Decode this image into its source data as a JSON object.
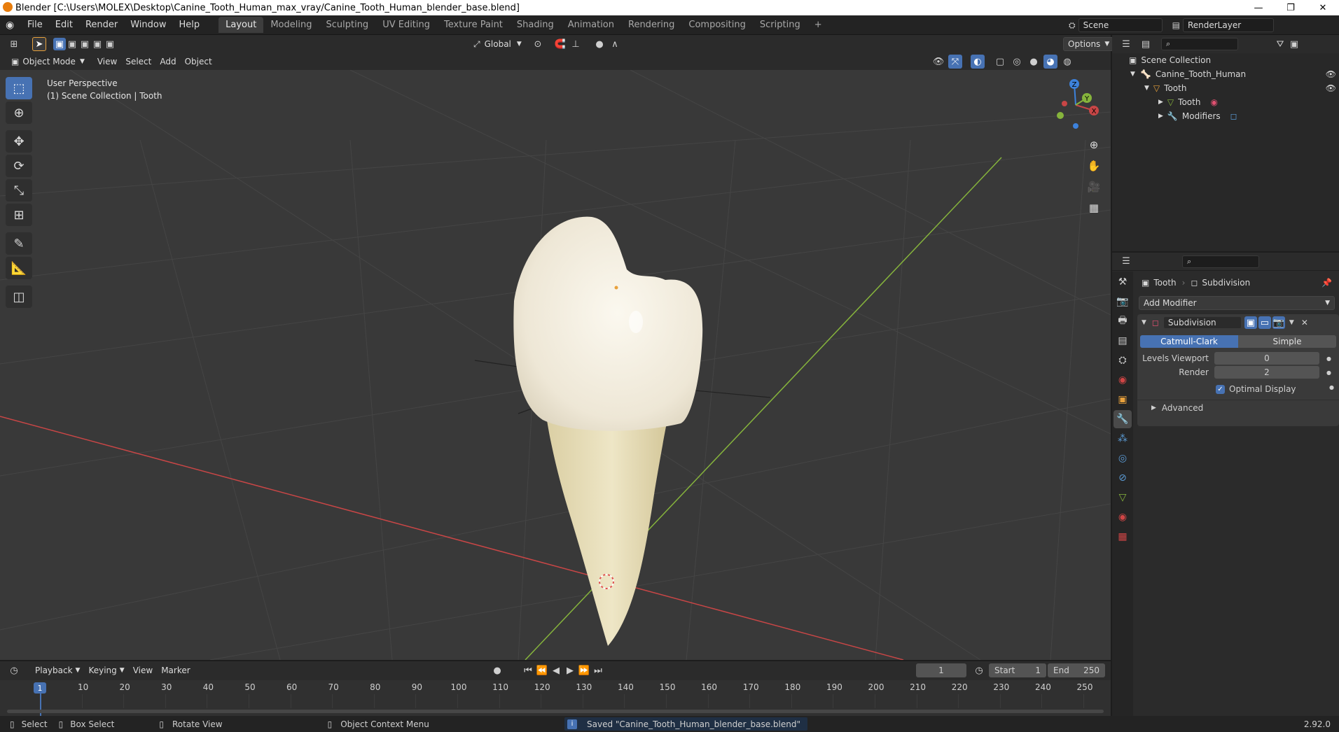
{
  "window": {
    "title": "Blender [C:\\Users\\MOLEX\\Desktop\\Canine_Tooth_Human_max_vray/Canine_Tooth_Human_blender_base.blend]",
    "minimize": "—",
    "restore": "❐",
    "close": "✕"
  },
  "menu": [
    "File",
    "Edit",
    "Render",
    "Window",
    "Help"
  ],
  "workspaces": [
    "Layout",
    "Modeling",
    "Sculpting",
    "UV Editing",
    "Texture Paint",
    "Shading",
    "Animation",
    "Rendering",
    "Compositing",
    "Scripting"
  ],
  "workspace_add": "+",
  "scene": {
    "name": "Scene",
    "renderlayer": "RenderLayer"
  },
  "viewport_header": {
    "transform_orientation": "Global",
    "options": "Options",
    "mode": "Object Mode",
    "menus": [
      "View",
      "Select",
      "Add",
      "Object"
    ]
  },
  "viewport": {
    "perspective": "User Perspective",
    "collection_info": "(1) Scene Collection | Tooth",
    "gizmo_axes": {
      "x": "X",
      "y": "Y",
      "z": "Z"
    }
  },
  "tools": [
    {
      "name": "select-box-tool",
      "glyph": "⬚",
      "active": true
    },
    {
      "name": "cursor-tool",
      "glyph": "⊕"
    },
    {
      "name": "move-tool",
      "glyph": "✥"
    },
    {
      "name": "rotate-tool",
      "glyph": "⟳"
    },
    {
      "name": "scale-tool",
      "glyph": "⤡"
    },
    {
      "name": "transform-tool",
      "glyph": "⊞"
    },
    {
      "name": "annotate-tool",
      "glyph": "✎"
    },
    {
      "name": "measure-tool",
      "glyph": "📏"
    },
    {
      "name": "add-cube-tool",
      "glyph": "◫"
    }
  ],
  "outliner": {
    "items": [
      {
        "label": "Scene Collection",
        "indent": 0
      },
      {
        "label": "Canine_Tooth_Human",
        "indent": 1
      },
      {
        "label": "Tooth",
        "indent": 2
      },
      {
        "label": "Tooth",
        "indent": 3
      },
      {
        "label": "Modifiers",
        "indent": 3
      }
    ]
  },
  "properties": {
    "breadcrumb_object": "Tooth",
    "breadcrumb_modifier": "Subdivision",
    "add_modifier": "Add Modifier",
    "modifier_name": "Subdivision",
    "catmull_clark": "Catmull-Clark",
    "simple": "Simple",
    "levels_viewport_label": "Levels Viewport",
    "levels_viewport_value": "0",
    "render_label": "Render",
    "render_value": "2",
    "optimal_display": "Optimal Display",
    "optimal_display_checked": true,
    "advanced": "Advanced"
  },
  "timeline": {
    "menus": [
      "Playback",
      "Keying",
      "View",
      "Marker"
    ],
    "current_frame": "1",
    "start_label": "Start",
    "start_value": "1",
    "end_label": "End",
    "end_value": "250",
    "ticks": [
      "10",
      "20",
      "30",
      "40",
      "50",
      "60",
      "70",
      "80",
      "90",
      "100",
      "110",
      "120",
      "130",
      "140",
      "150",
      "160",
      "170",
      "180",
      "190",
      "200",
      "210",
      "220",
      "230",
      "240",
      "250"
    ],
    "playhead": "1"
  },
  "statusbar": {
    "select": "Select",
    "box_select": "Box Select",
    "rotate_view": "Rotate View",
    "context_menu": "Object Context Menu",
    "message": "Saved \"Canine_Tooth_Human_blender_base.blend\"",
    "version": "2.92.0"
  },
  "colors": {
    "accent": "#4772b3",
    "x_axis": "#c84646",
    "y_axis": "#86b43c",
    "z_axis": "#3d82dc",
    "tooth_crown": "#f4efe2",
    "tooth_root": "#e6dbb4"
  }
}
